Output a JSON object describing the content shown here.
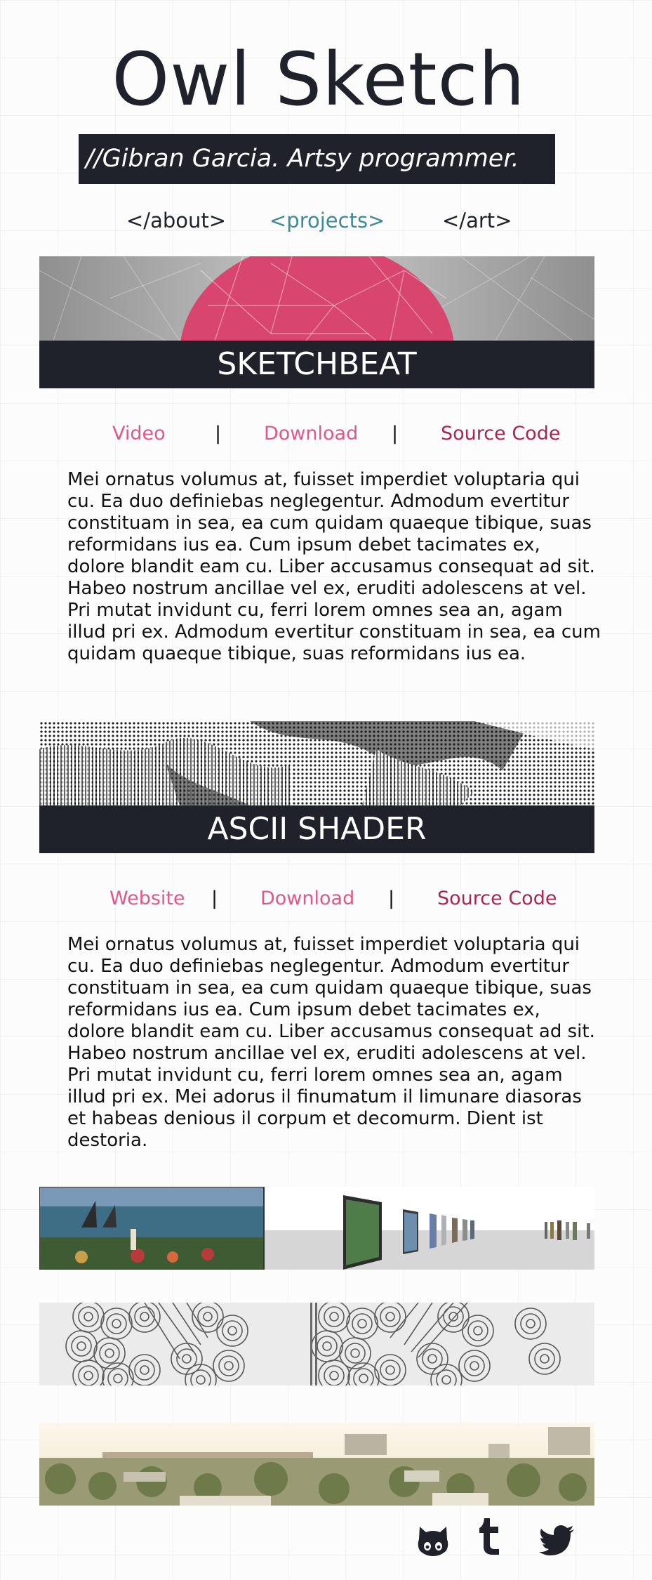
{
  "site": {
    "title": "Owl Sketch",
    "tagline": "//Gibran Garcia. Artsy programmer."
  },
  "nav": {
    "items": [
      {
        "label": "</about>"
      },
      {
        "label": "<projects>"
      },
      {
        "label": "</art>"
      }
    ]
  },
  "projects": [
    {
      "title": "SKETCHBEAT",
      "links": [
        "Video",
        "Download",
        "Source Code"
      ],
      "separator": "|",
      "description": "Mei ornatus volumus at, fuisset imperdiet voluptaria qui cu. Ea duo definiebas neglegentur. Admodum evertitur constituam in sea, ea cum quidam quaeque tibique, suas reformidans ius ea. Cum ipsum debet tacimates ex, dolore blandit eam cu. Liber accusamus consequat ad sit. Habeo nostrum ancillae vel ex, eruditi adolescens at vel. Pri mutat invidunt cu, ferri lorem omnes sea an, agam illud pri ex. Admodum evertitur constituam in sea, ea cum quidam quaeque tibique, suas reformidans ius ea."
    },
    {
      "title": "ASCII SHADER",
      "links": [
        "Website",
        "Download",
        "Source Code"
      ],
      "separator": "|",
      "description": "Mei ornatus volumus at, fuisset imperdiet voluptaria qui cu. Ea duo definiebas neglegentur. Admodum evertitur constituam in sea, ea cum quidam quaeque tibique, suas reformidans ius ea. Cum ipsum debet tacimates ex, dolore blandit eam cu. Liber accusamus consequat ad sit. Habeo nostrum ancillae vel ex, eruditi adolescens at vel. Pri mutat invidunt cu, ferri lorem omnes sea an, agam illud pri ex. Mei adorus il finumatum il limunare diasoras et habeas denious il corpum et decomurm. Dient ist destoria."
    }
  ],
  "thumbnails": [
    {
      "icon": "gallery-thumbnail"
    },
    {
      "icon": "circles-pattern-thumbnail"
    },
    {
      "icon": "city-skyline-thumbnail"
    }
  ],
  "social": [
    {
      "icon": "github-icon"
    },
    {
      "icon": "tumblr-icon"
    },
    {
      "icon": "twitter-icon"
    }
  ],
  "colors": {
    "dark": "#1f212b",
    "accent": "#e0578a",
    "accent_dark": "#a8264f",
    "nav_active": "#3d8a9b"
  }
}
